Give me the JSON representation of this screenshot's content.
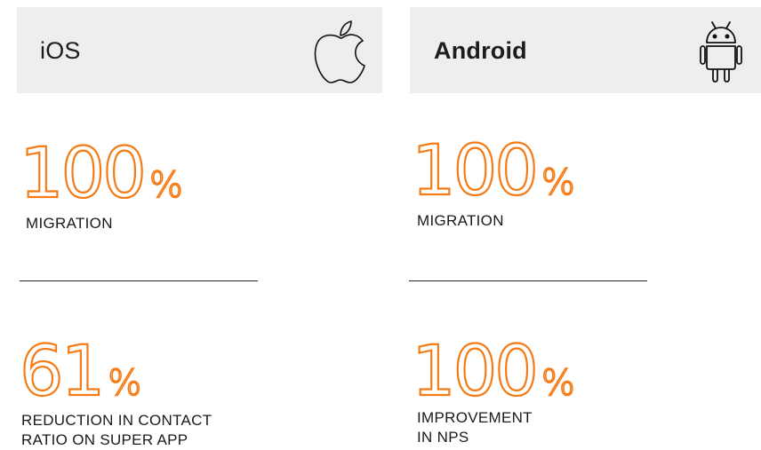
{
  "ios": {
    "title": "iOS",
    "icon": "apple-icon",
    "stats": [
      {
        "value": "100",
        "unit": "%",
        "caption": "MIGRATION"
      },
      {
        "value": "61",
        "unit": "%",
        "caption": "REDUCTION IN CONTACT\nRATIO ON SUPER APP"
      }
    ]
  },
  "android": {
    "title": "Android",
    "icon": "android-icon",
    "stats": [
      {
        "value": "100",
        "unit": "%",
        "caption": "MIGRATION"
      },
      {
        "value": "100",
        "unit": "%",
        "caption": "IMPROVEMENT\nIN NPS"
      }
    ]
  },
  "colors": {
    "accent": "#f47b16",
    "header_bg": "#eeeeee",
    "text": "#1a1a1a"
  }
}
